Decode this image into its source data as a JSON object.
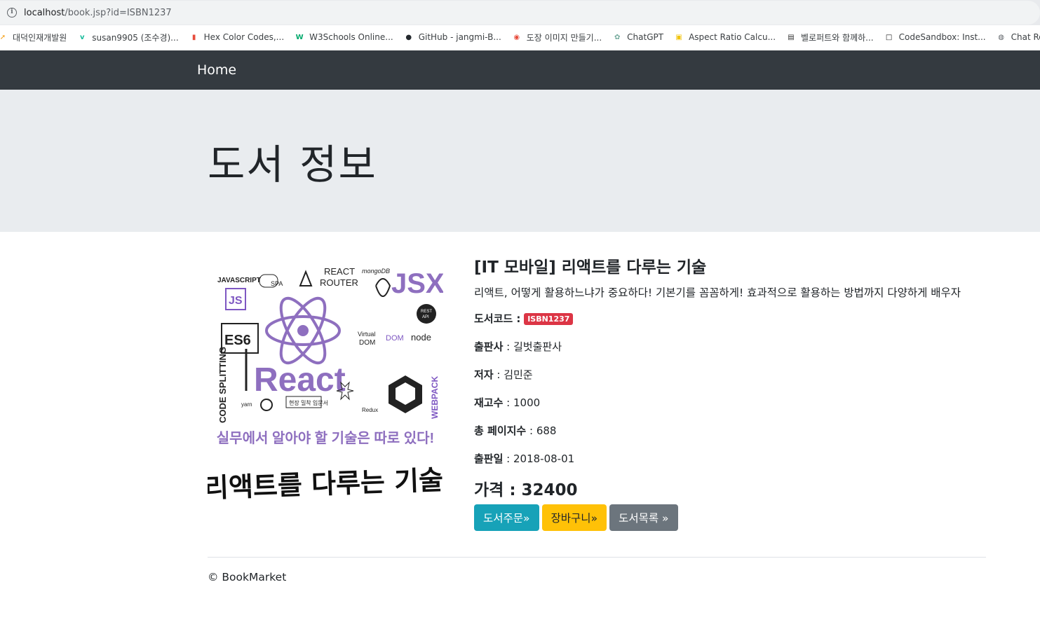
{
  "browser": {
    "url_host": "localhost",
    "url_path": "/book.jsp?id=ISBN1237",
    "bookmarks": [
      {
        "label": "대덕인재개발원",
        "icon": "arrow-icon",
        "color": "#f39c12"
      },
      {
        "label": "susan9905 (조수경)...",
        "icon": "v-icon",
        "color": "#1abc9c"
      },
      {
        "label": "Hex Color Codes,...",
        "icon": "palette-icon",
        "color": "#e74c3c"
      },
      {
        "label": "W3Schools Online...",
        "icon": "w3-icon",
        "color": "#04aa6d"
      },
      {
        "label": "GitHub - jangmi-B...",
        "icon": "github-icon",
        "color": "#24292e"
      },
      {
        "label": "도장 이미지 만들기...",
        "icon": "stamp-icon",
        "color": "#e74c3c"
      },
      {
        "label": "ChatGPT",
        "icon": "chatgpt-icon",
        "color": "#74aa9c"
      },
      {
        "label": "Aspect Ratio Calcu...",
        "icon": "aspect-icon",
        "color": "#f1c40f"
      },
      {
        "label": "벨로퍼트와 함께하...",
        "icon": "book-icon",
        "color": "#333333"
      },
      {
        "label": "CodeSandbox: Inst...",
        "icon": "sandbox-icon",
        "color": "#151515"
      },
      {
        "label": "Chat Roor",
        "icon": "globe-icon",
        "color": "#5f6368"
      }
    ]
  },
  "nav": {
    "brand": "Home"
  },
  "jumbotron": {
    "title": "도서 정보"
  },
  "cover": {
    "top_words": [
      "JAVASCRIPT",
      "SPA",
      "REACT ROUTER",
      "mongoDB",
      "JSX",
      "JS",
      "ES6",
      "DOM",
      "Virtual DOM",
      "node",
      "REST API",
      "CODE SPLITTING",
      "React",
      "WEBPACK",
      "yarn",
      "Redux",
      "현장 밀착 입문서"
    ],
    "slogan": "실무에서 알아야 할 기술은 따로 있다!",
    "title": "리액트를 다루는 기술"
  },
  "book": {
    "name": "[IT 모바일] 리액트를 다루는 기술",
    "description": "리액트, 어떻게 활용하느냐가 중요하다! 기본기를 꼼꼼하게! 효과적으로 활용하는 방법까지 다양하게 배우자",
    "code_label": "도서코드 :",
    "code": "ISBN1237",
    "publisher_label": "출판사",
    "publisher": " : 길벗출판사",
    "author_label": "저자",
    "author": " : 김민준",
    "stock_label": "재고수",
    "stock": " : 1000",
    "pages_label": "총 페이지수",
    "pages": " : 688",
    "date_label": "출판일",
    "date": " : 2018-08-01",
    "price_label": "가격 : ",
    "price": "32400"
  },
  "buttons": {
    "order": "도서주문»",
    "cart": "장바구니»",
    "list": "도서목록 »"
  },
  "footer": {
    "text": "© BookMarket"
  }
}
